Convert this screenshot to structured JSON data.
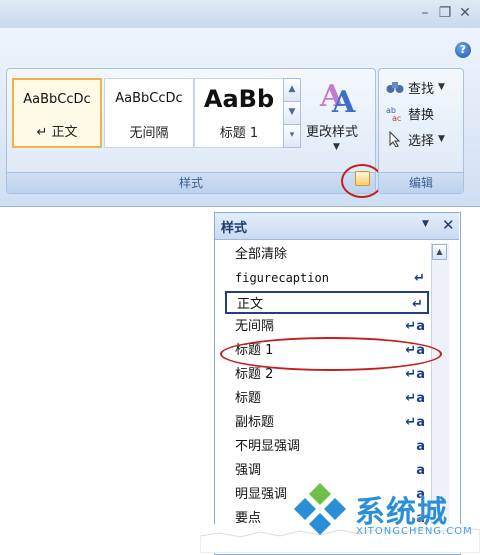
{
  "window": {
    "minimize_glyph": "–",
    "restore_glyph": "❐",
    "close_glyph": "✕",
    "help_glyph": "?"
  },
  "ribbon": {
    "styles_group": {
      "label": "样式",
      "swatches": [
        {
          "preview": "AaBbCcDc",
          "name": "↵ 正文",
          "selected": true
        },
        {
          "preview": "AaBbCcDc",
          "name": "无间隔",
          "selected": false
        },
        {
          "preview": "AaBb",
          "name": "标题 1",
          "selected": false
        }
      ],
      "change_styles_label": "更改样式",
      "launcher_icon": "dialog-launcher-icon"
    },
    "editing_group": {
      "label": "编辑",
      "items": [
        {
          "label": "查找",
          "icon": "binoculars-icon"
        },
        {
          "label": "替换",
          "icon": "replace-icon"
        },
        {
          "label": "选择",
          "icon": "cursor-arrow-icon"
        }
      ]
    }
  },
  "styles_pane": {
    "title": "样式",
    "menu_glyph": "▼",
    "close_glyph": "✕",
    "items": [
      {
        "label": "全部清除",
        "mark": ""
      },
      {
        "label": "figurecaption",
        "mark": "↵"
      },
      {
        "label": "正文",
        "mark": "↵"
      },
      {
        "label": "无间隔",
        "mark": "↵a"
      },
      {
        "label": "标题 1",
        "mark": "↵a"
      },
      {
        "label": "标题 2",
        "mark": "↵a"
      },
      {
        "label": "标题",
        "mark": "↵a"
      },
      {
        "label": "副标题",
        "mark": "↵a"
      },
      {
        "label": "不明显强调",
        "mark": "a"
      },
      {
        "label": "强调",
        "mark": "a"
      },
      {
        "label": "明显强调",
        "mark": "a"
      },
      {
        "label": "要点",
        "mark": "a"
      }
    ]
  },
  "watermark": {
    "text": "系统城",
    "domain": "XITONGCHENG.COM"
  },
  "colors": {
    "highlight_ring": "#c61d1d",
    "selected_swatch": "#f0b34c",
    "ribbon_label": "#3d5f93"
  }
}
